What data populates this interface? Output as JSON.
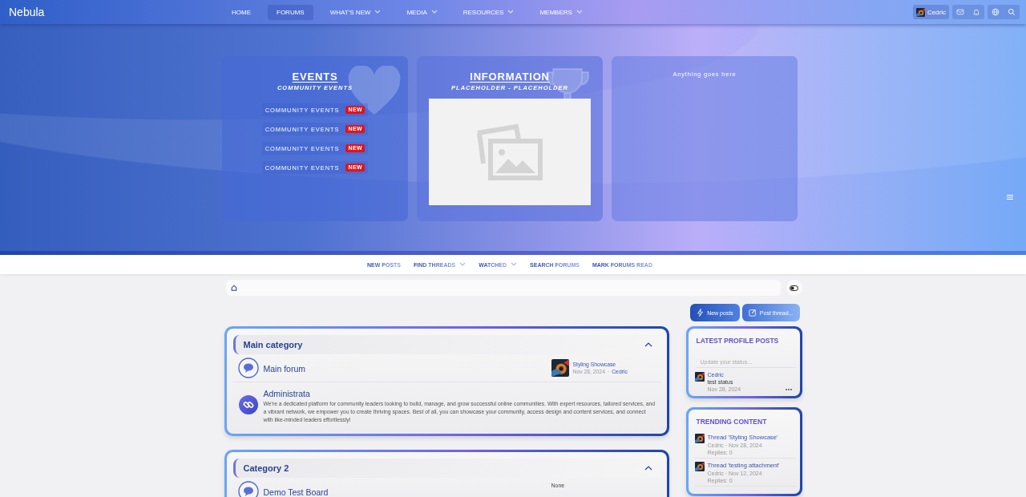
{
  "header": {
    "logo": "Nebula",
    "nav": [
      {
        "label": "HOME",
        "selected": false,
        "dropdown": false
      },
      {
        "label": "FORUMS",
        "selected": true,
        "dropdown": false
      },
      {
        "label": "WHAT'S NEW",
        "selected": false,
        "dropdown": true
      },
      {
        "label": "MEDIA",
        "selected": false,
        "dropdown": true
      },
      {
        "label": "RESOURCES",
        "selected": false,
        "dropdown": true
      },
      {
        "label": "MEMBERS",
        "selected": false,
        "dropdown": true
      }
    ],
    "user": "Cedric"
  },
  "hero": {
    "cards": [
      {
        "kind": "events",
        "title": "EVENTS",
        "subtitle": "COMMUNITY EVENTS",
        "items": [
          {
            "label": "COMMUNITY EVENTS",
            "badge": "NEW"
          },
          {
            "label": "COMMUNITY EVENTS",
            "badge": "NEW"
          },
          {
            "label": "COMMUNITY EVENTS",
            "badge": "NEW"
          },
          {
            "label": "COMMUNITY EVENTS",
            "badge": "NEW"
          }
        ]
      },
      {
        "kind": "info",
        "title": "INFORMATION",
        "subtitle": "PLACEHOLDER - PLACEHOLDER"
      },
      {
        "kind": "text",
        "text": "Anything goes here"
      }
    ]
  },
  "subnav": [
    {
      "first": "NEW",
      "rest": "POSTS",
      "dropdown": false
    },
    {
      "first": "FIND",
      "rest": "THREADS",
      "dropdown": true
    },
    {
      "first": "WATCHED",
      "dropdown": true
    },
    {
      "first": "SEARCH",
      "rest": "FORUMS",
      "dropdown": false
    },
    {
      "first": "MARK FORUMS",
      "rest": "READ",
      "dropdown": false
    }
  ],
  "actions": [
    {
      "kind": "new",
      "label": "New posts"
    },
    {
      "kind": "post",
      "label": "Post thread..."
    }
  ],
  "categories": [
    {
      "title": "Main category",
      "expanded": true,
      "forums": [
        {
          "kind": "forum",
          "title": "Main forum",
          "latest": {
            "title": "Styling Showcase",
            "date": "Nov 28, 2024",
            "separator": "·",
            "user": "Cedric"
          }
        },
        {
          "kind": "link",
          "title": "Administrata",
          "description": "We're a dedicated platform for community leaders looking to build, manage, and grow successful online communities. With expert resources, tailored services, and a vibrant network, we empower you to create thriving spaces. Best of all, you can showcase your community, access design and content services, and connect with like-minded leaders effortlessly!"
        }
      ]
    },
    {
      "title": "Category 2",
      "expanded": true,
      "forums": [
        {
          "kind": "forum",
          "title": "Demo Test Board",
          "none": "None"
        }
      ]
    }
  ],
  "sidebar": [
    {
      "kind": "profile_posts",
      "title": "LATEST PROFILE POSTS",
      "placeholder": "Update your status...",
      "posts": [
        {
          "user": "Cedric",
          "text": "test status",
          "date": "Nov 28, 2024"
        }
      ]
    },
    {
      "kind": "trending",
      "title": "TRENDING CONTENT",
      "items": [
        {
          "title": "Thread 'Styling Showcase'",
          "meta": "Cedric · Nov 28, 2024",
          "replies": "Replies: 0"
        },
        {
          "title": "Thread 'testing attachment'",
          "meta": "Cedric · Nov 12, 2024",
          "replies": "Replies: 0"
        }
      ]
    }
  ]
}
